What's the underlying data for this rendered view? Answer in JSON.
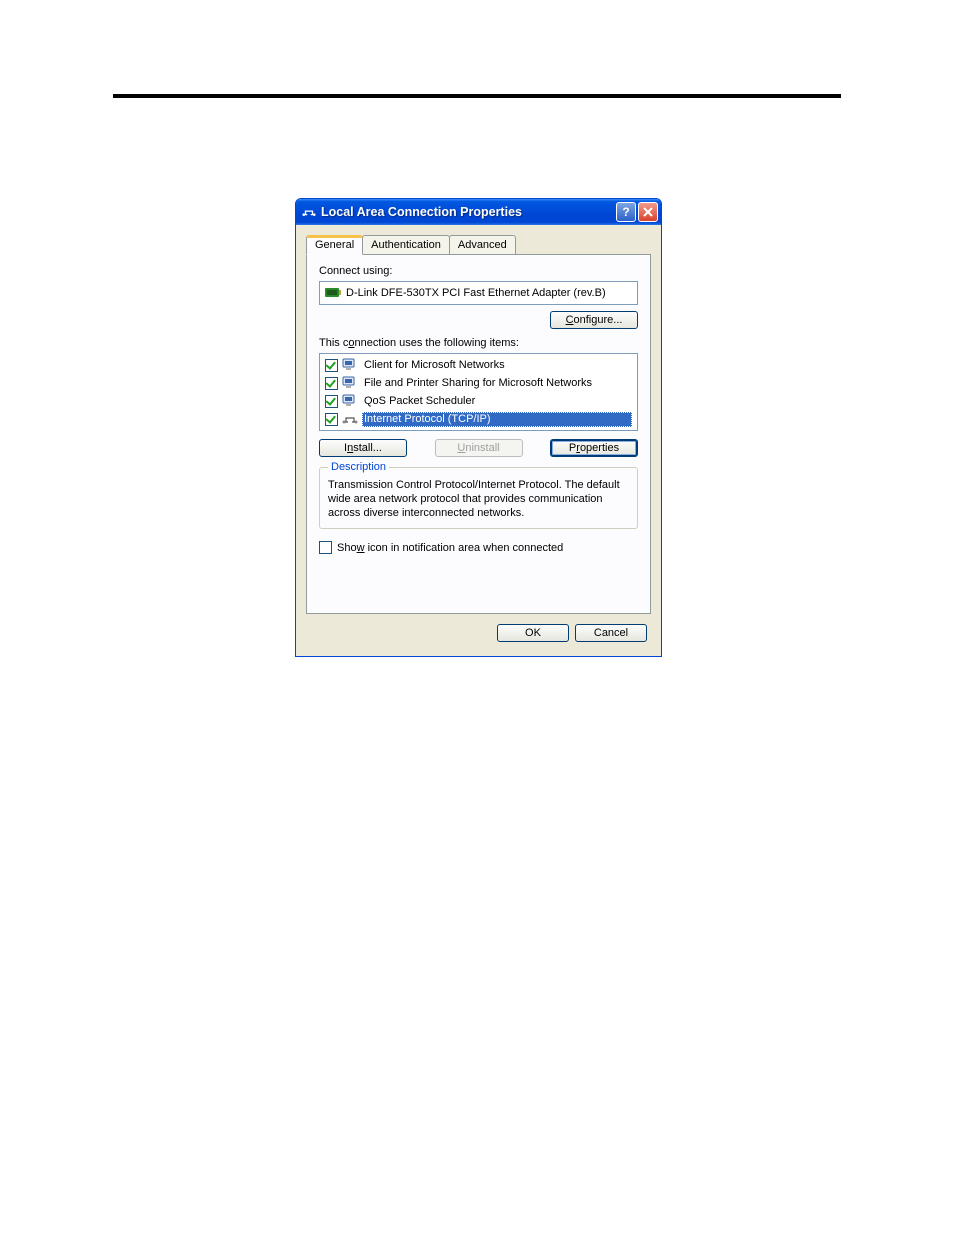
{
  "window": {
    "title": "Local Area Connection Properties"
  },
  "tabs": {
    "general": "General",
    "authentication": "Authentication",
    "advanced": "Advanced"
  },
  "general": {
    "connect_using_label": "Connect using:",
    "adapter": "D-Link DFE-530TX PCI Fast Ethernet Adapter (rev.B)",
    "configure_btn": "Configure...",
    "items_label": "This connection uses the following items:",
    "items": [
      {
        "label": "Client for Microsoft Networks",
        "checked": true,
        "selected": false,
        "icon": "monitor"
      },
      {
        "label": "File and Printer Sharing for Microsoft Networks",
        "checked": true,
        "selected": false,
        "icon": "monitor"
      },
      {
        "label": "QoS Packet Scheduler",
        "checked": true,
        "selected": false,
        "icon": "monitor"
      },
      {
        "label": "Internet Protocol (TCP/IP)",
        "checked": true,
        "selected": true,
        "icon": "protocol"
      }
    ],
    "install_btn": "Install...",
    "uninstall_btn": "Uninstall",
    "properties_btn": "Properties",
    "description_legend": "Description",
    "description_text": "Transmission Control Protocol/Internet Protocol. The default wide area network protocol that provides communication across diverse interconnected networks.",
    "show_icon_label": "Show icon in notification area when connected",
    "show_icon_checked": false
  },
  "footer": {
    "ok": "OK",
    "cancel": "Cancel"
  }
}
